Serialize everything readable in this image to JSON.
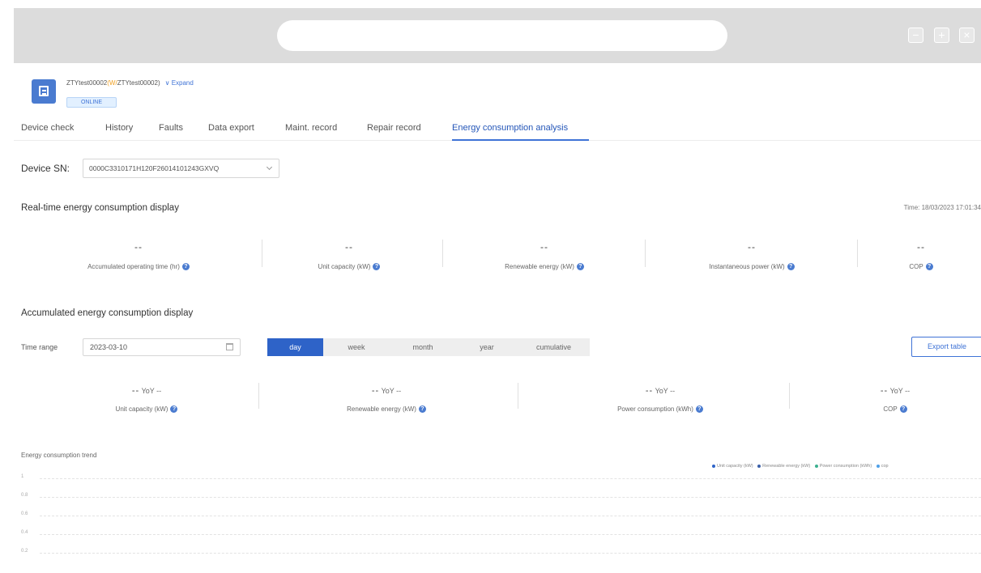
{
  "window": {
    "minimize": "−",
    "maximize": "+",
    "close": "×"
  },
  "device": {
    "name_primary": "ZTYtest00002",
    "name_sep": "(W/",
    "name_secondary": "ZTYtest00002)",
    "expand": "∨ Expand",
    "status": "ONLINE"
  },
  "tabs": [
    "Device check",
    "History",
    "Faults",
    "Data export",
    "Maint. record",
    "Repair record",
    "Energy consumption analysis"
  ],
  "active_tab": "Energy consumption analysis",
  "device_sn": {
    "label": "Device SN:",
    "value": "0000C3310171H120F26014101243GXVQ"
  },
  "realtime": {
    "title": "Real-time energy consumption display",
    "time": "Time: 18/03/2023 17:01:34",
    "metrics": [
      {
        "value": "--",
        "label": "Accumulated operating time (hr)"
      },
      {
        "value": "--",
        "label": "Unit capacity (kW)"
      },
      {
        "value": "--",
        "label": "Renewable energy (kW)"
      },
      {
        "value": "--",
        "label": "Instantaneous power (kW)"
      },
      {
        "value": "--",
        "label": "COP"
      }
    ]
  },
  "accumulated": {
    "title": "Accumulated energy consumption display",
    "time_range_label": "Time range",
    "date": "2023-03-10",
    "periods": [
      "day",
      "week",
      "month",
      "year",
      "cumulative"
    ],
    "active_period": "day",
    "export": "Export table",
    "metrics": [
      {
        "value": "--",
        "yoy": "YoY --",
        "label": "Unit capacity (kW)"
      },
      {
        "value": "--",
        "yoy": "YoY --",
        "label": "Renewable energy (kW)"
      },
      {
        "value": "--",
        "yoy": "YoY --",
        "label": "Power consumption (kWh)"
      },
      {
        "value": "--",
        "yoy": "YoY --",
        "label": "COP"
      }
    ]
  },
  "trend": {
    "title": "Energy consumption trend",
    "legend": [
      {
        "name": "Unit capacity (kW)",
        "color": "#2e63c8"
      },
      {
        "name": "Renewable energy (kW)",
        "color": "#3a5fa8"
      },
      {
        "name": "Power consumption (kWh)",
        "color": "#3bb08f"
      },
      {
        "name": "cop",
        "color": "#4ea0e8"
      }
    ],
    "y_ticks": [
      "1",
      "0.8",
      "0.6",
      "0.4",
      "0.2"
    ]
  },
  "colors": {
    "accent": "#2e63c8",
    "chrome": "#dcdcdc"
  }
}
